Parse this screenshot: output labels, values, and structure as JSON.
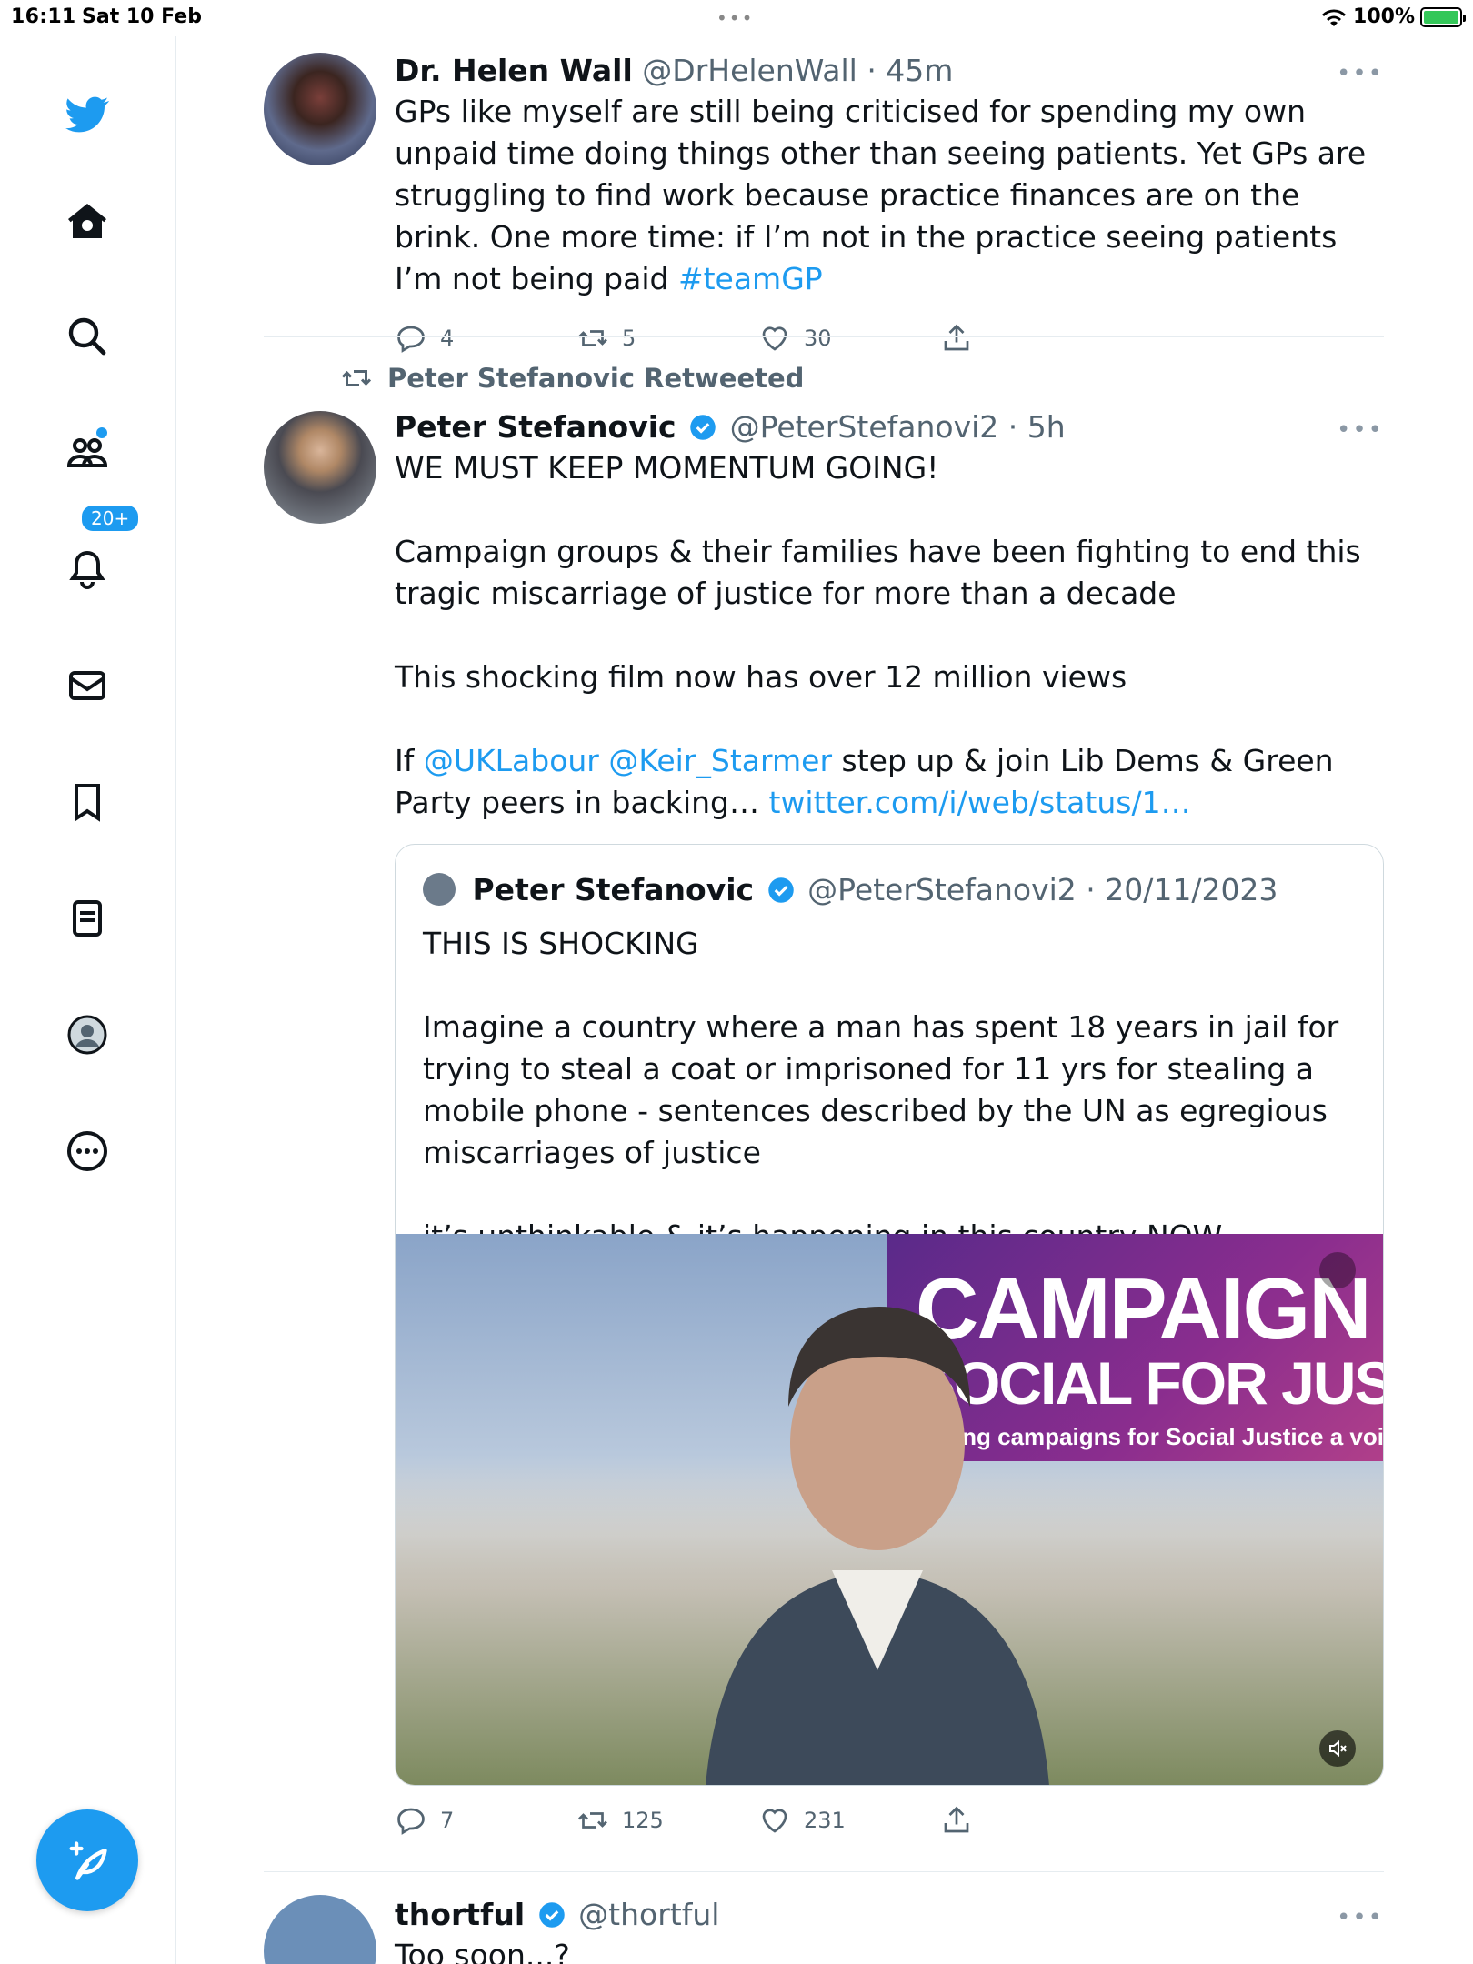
{
  "status_bar": {
    "time": "16:11",
    "date": "Sat 10 Feb",
    "battery": "100%"
  },
  "sidebar": {
    "items": [
      {
        "name": "twitter-logo"
      },
      {
        "name": "home"
      },
      {
        "name": "search"
      },
      {
        "name": "communities"
      },
      {
        "name": "notifications",
        "badge": "20+"
      },
      {
        "name": "messages"
      },
      {
        "name": "bookmarks"
      },
      {
        "name": "lists"
      },
      {
        "name": "profile"
      },
      {
        "name": "more"
      }
    ],
    "compose_label": "Compose"
  },
  "colors": {
    "accent": "#1d9bf0",
    "text": "#0f1419",
    "secondary": "#536471"
  },
  "tweets": [
    {
      "name": "Dr. Helen Wall",
      "handle_time": "@DrHelenWall · 45m",
      "text_main": "GPs like myself are still being criticised for spending my own unpaid time doing things other than seeing patients. Yet GPs are struggling to find work because practice finances are on the brink. One more time: if I’m not in the practice seeing patients I’m not being paid ",
      "hashtag": "#teamGP",
      "replies": "4",
      "retweets": "5",
      "likes": "30"
    },
    {
      "retweeted_by": "Peter Stefanovic Retweeted",
      "name": "Peter Stefanovic",
      "handle_time": "@PeterStefanovi2 · 5h",
      "p1": "WE MUST KEEP MOMENTUM GOING!",
      "p2": "Campaign groups & their families have been fighting to end this tragic miscarriage of justice for more than a decade",
      "p3": "This shocking film now has over 12 million views",
      "p4_a": "If ",
      "mention1": "@UKLabour",
      "mention2": "@Keir_Starmer",
      "p4_b": " step up & join Lib Dems & Green Party peers in backing… ",
      "link": "twitter.com/i/web/status/1…",
      "quote": {
        "name": "Peter Stefanovic",
        "handle_date": "@PeterStefanovi2 · 20/11/2023",
        "q1": "THIS IS SHOCKING",
        "q2": "Imagine a country where a man has spent 18 years in jail for trying to steal a coat or imprisoned for 11 yrs for stealing a mobile phone - sentences described by the UN as egregious miscarriages of justice",
        "q3": "it’s unthinkable & it’s happening in this country NOW",
        "banner_line1": "CAMPAIGN",
        "banner_line2": "SOCIAL FOR JUSTICE",
        "banner_line3": "Giving campaigns for Social Justice a voice"
      },
      "replies": "7",
      "retweets": "125",
      "likes": "231"
    },
    {
      "name": "thortful",
      "handle": "@thortful",
      "text": "Too soon...?"
    }
  ]
}
